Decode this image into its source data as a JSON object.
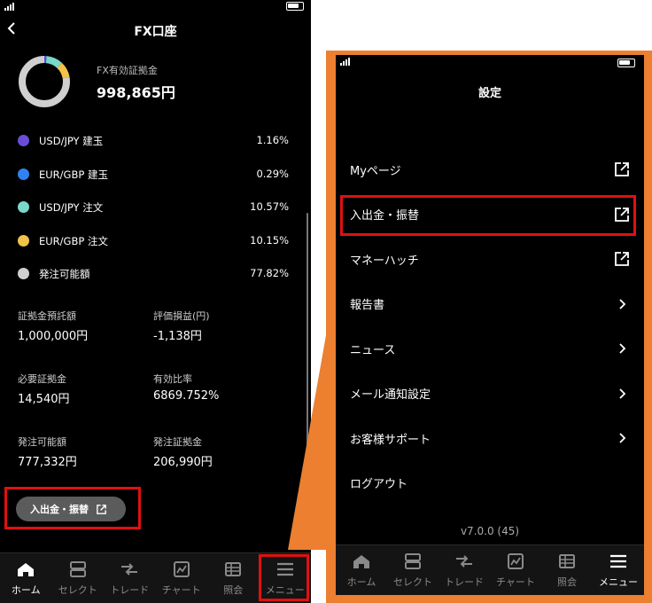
{
  "left": {
    "title": "FX口座",
    "balance_label": "FX有効証拠金",
    "balance_value": "998,865円",
    "donut": [
      {
        "value": 1.16,
        "color": "#6a4cd8"
      },
      {
        "value": 0.29,
        "color": "#2f82f0"
      },
      {
        "value": 10.57,
        "color": "#79d8c8"
      },
      {
        "value": 10.15,
        "color": "#f2c24a"
      },
      {
        "value": 77.82,
        "color": "#cfcfcf"
      }
    ],
    "legend": [
      {
        "name": "USD/JPY 建玉",
        "value": "1.16%",
        "color": "#6a4cd8"
      },
      {
        "name": "EUR/GBP 建玉",
        "value": "0.29%",
        "color": "#2f82f0"
      },
      {
        "name": "USD/JPY 注文",
        "value": "10.57%",
        "color": "#79d8c8"
      },
      {
        "name": "EUR/GBP 注文",
        "value": "10.15%",
        "color": "#f2c24a"
      },
      {
        "name": "発注可能額",
        "value": "77.82%",
        "color": "#cfcfcf"
      }
    ],
    "stats": [
      {
        "label": "証拠金預託額",
        "value": "1,000,000円"
      },
      {
        "label": "評価損益(円)",
        "value": "-1,138円"
      },
      {
        "label": "必要証拠金",
        "value": "14,540円"
      },
      {
        "label": "有効比率",
        "value": "6869.752%"
      },
      {
        "label": "発注可能額",
        "value": "777,332円"
      },
      {
        "label": "発注証拠金",
        "value": "206,990円"
      }
    ],
    "transfer_button": "入出金・振替"
  },
  "tabs": [
    {
      "label": "ホーム",
      "icon": "home-icon"
    },
    {
      "label": "セレクト",
      "icon": "select-icon"
    },
    {
      "label": "トレード",
      "icon": "trade-icon"
    },
    {
      "label": "チャート",
      "icon": "chart-icon"
    },
    {
      "label": "照会",
      "icon": "inquiry-icon"
    },
    {
      "label": "メニュー",
      "icon": "menu-icon"
    }
  ],
  "right": {
    "title": "設定",
    "menu": [
      {
        "label": "Myページ",
        "icon": "external-link-icon"
      },
      {
        "label": "入出金・振替",
        "icon": "external-link-icon"
      },
      {
        "label": "マネーハッチ",
        "icon": "external-link-icon"
      },
      {
        "label": "報告書",
        "icon": "chevron-right-icon"
      },
      {
        "label": "ニュース",
        "icon": "chevron-right-icon"
      },
      {
        "label": "メール通知設定",
        "icon": "chevron-right-icon"
      },
      {
        "label": "お客様サポート",
        "icon": "chevron-right-icon"
      },
      {
        "label": "ログアウト",
        "icon": ""
      }
    ],
    "version": "v7.0.0 (45)"
  },
  "colors": {
    "highlight": "#e01010",
    "frame": "#ec7f30",
    "active_tab": "#ffffff"
  }
}
